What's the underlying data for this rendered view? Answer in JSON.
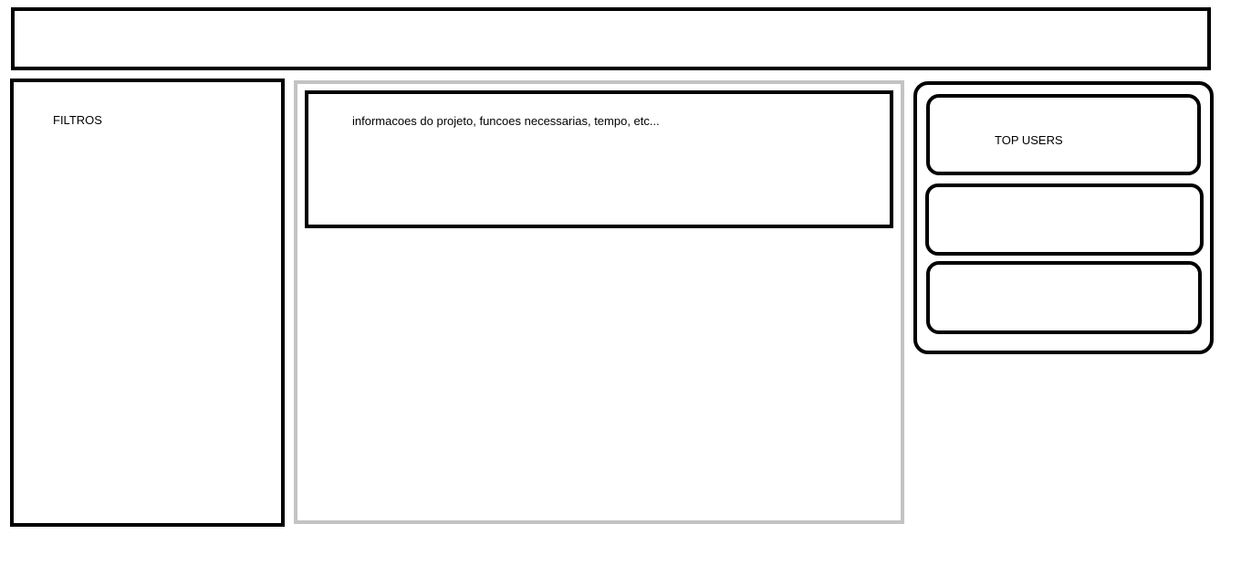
{
  "filters": {
    "label": "FILTROS"
  },
  "project": {
    "info": "informacoes do projeto, funcoes necessarias, tempo, etc..."
  },
  "top_users": {
    "label": "TOP USERS"
  },
  "colors": {
    "border": "#000000",
    "main_panel_border": "#c3c3c3",
    "background": "#ffffff"
  }
}
